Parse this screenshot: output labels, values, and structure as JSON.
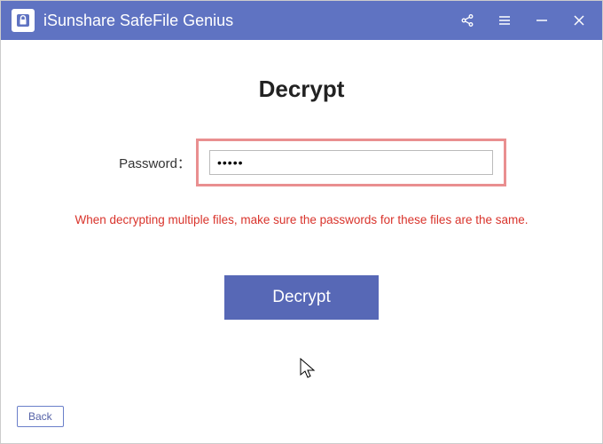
{
  "titlebar": {
    "app_name": "iSunshare SafeFile Genius"
  },
  "main": {
    "heading": "Decrypt",
    "password_label": "Password：",
    "password_value": "•••••",
    "warning": "When decrypting multiple files, make sure the passwords for these files are the same.",
    "decrypt_button": "Decrypt",
    "back_button": "Back"
  }
}
